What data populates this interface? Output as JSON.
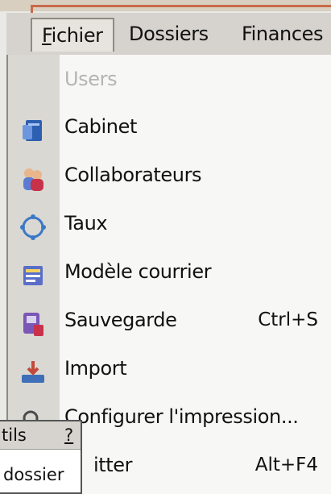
{
  "menubar": {
    "items": [
      {
        "label_prefix": "F",
        "label_rest": "ichier",
        "state": "open"
      },
      {
        "label": "Dossiers"
      },
      {
        "label": "Finances"
      }
    ]
  },
  "fichier_menu": {
    "items": [
      {
        "label": "Users",
        "disabled": true,
        "icon": ""
      },
      {
        "label": "Cabinet",
        "icon": "cabinet-icon",
        "color": "#2d5fb3"
      },
      {
        "label": "Collaborateurs",
        "icon": "users-icon",
        "color": "#7a3c9e"
      },
      {
        "label": "Taux",
        "icon": "rate-icon",
        "color": "#3c78c6"
      },
      {
        "label": "Modèle courrier",
        "icon": "letter-template-icon",
        "color": "#5a6ec8"
      },
      {
        "label": "Sauvegarde",
        "icon": "backup-icon",
        "color": "#7a56b6",
        "shortcut": "Ctrl+S"
      },
      {
        "label": "Import",
        "icon": "import-icon",
        "color": "#c34a3a"
      },
      {
        "label": "Configurer l'impression...",
        "icon": "print-setup-icon",
        "color": "#4b4b4b"
      },
      {
        "label": "itter",
        "icon": "",
        "shortcut": "Alt+F4"
      }
    ]
  },
  "overlay_window": {
    "row1_text": "tils",
    "row1_help": "?",
    "row2_text": "dossier"
  }
}
